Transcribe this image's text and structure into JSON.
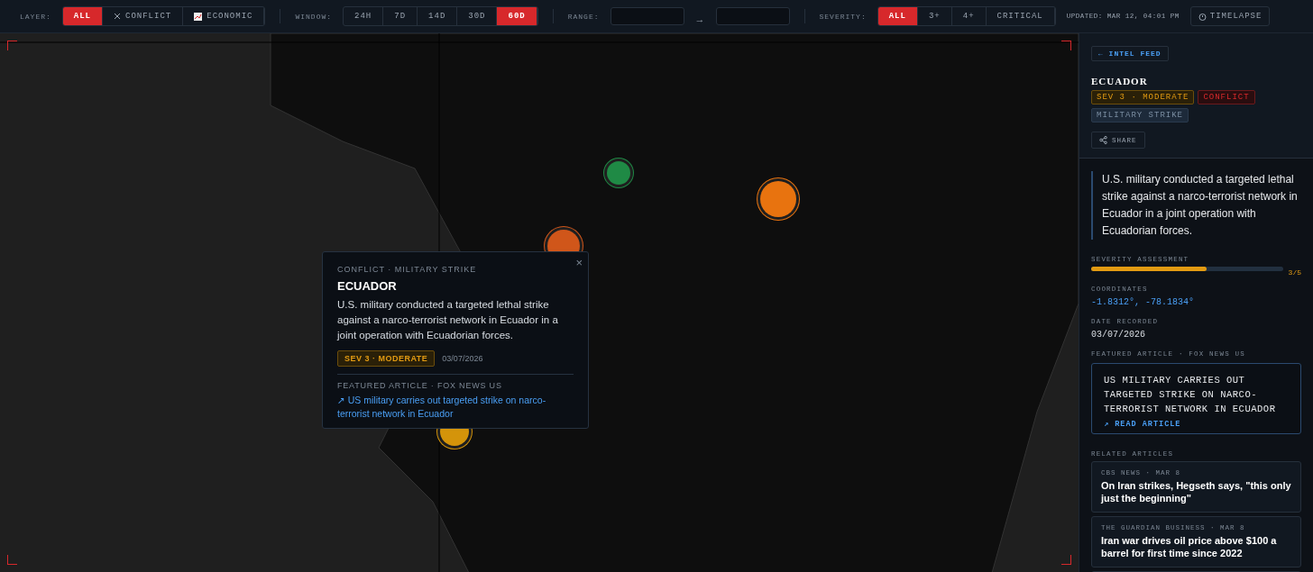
{
  "toolbar": {
    "groups": [
      {
        "label": "LAYER:",
        "options": [
          {
            "text": "ALL",
            "selected": true
          },
          {
            "text": "CONFLICT",
            "selected": false
          },
          {
            "text": "ECONOMIC",
            "selected": false
          }
        ]
      },
      {
        "label": "WINDOW:",
        "options": [
          {
            "text": "24H",
            "selected": false
          },
          {
            "text": "7D",
            "selected": false
          },
          {
            "text": "14D",
            "selected": false
          },
          {
            "text": "30D",
            "selected": false
          },
          {
            "text": "60D",
            "selected": true
          }
        ]
      }
    ],
    "range": {
      "label": "RANGE:",
      "arrow": "→"
    },
    "severity": {
      "label": "SEVERITY:",
      "options": [
        {
          "text": "ALL",
          "selected": true
        },
        {
          "text": "3+",
          "selected": false
        },
        {
          "text": "4+",
          "selected": false
        },
        {
          "text": "CRITICAL",
          "selected": false
        }
      ]
    },
    "updated": "UPDATED: MAR 12, 04:01 PM",
    "timelapse": "TIMELAPSE"
  },
  "map": {
    "markers": [
      {
        "color": "#1f8a45"
      },
      {
        "color": "#e8730f"
      },
      {
        "color": "#d0561a"
      },
      {
        "color": "#d4940a"
      }
    ],
    "popup": {
      "category": "CONFLICT · MILITARY STRIKE",
      "close": "×",
      "title": "ECUADOR",
      "body": "U.S. military conducted a targeted lethal strike against a narco-terrorist network in Ecuador in a joint operation with Ecuadorian forces.",
      "severity": "SEV 3 · MODERATE",
      "date": "03/07/2026",
      "featured_label": "FEATURED ARTICLE · FOX NEWS US",
      "link": "↗ US military carries out targeted strike on narco-terrorist network in Ecuador"
    }
  },
  "detail": {
    "back": "← INTEL FEED",
    "title": "ECUADOR",
    "tags": [
      {
        "text": "SEV 3 · MODERATE",
        "kind": "severity"
      },
      {
        "text": "CONFLICT",
        "kind": "category"
      },
      {
        "text": "MILITARY STRIKE",
        "kind": "type"
      }
    ],
    "share": "SHARE",
    "summary": "U.S. military conducted a targeted lethal strike against a narco-terrorist network in Ecuador in a joint operation with Ecuadorian forces.",
    "severity": {
      "label": "SEVERITY ASSESSMENT",
      "level": 0.6,
      "value": "3/5"
    },
    "coordinates_label": "COORDINATES",
    "coordinates": "-1.8312°, -78.1834°",
    "date_label": "DATE RECORDED",
    "date": "03/07/2026",
    "featured_label": "FEATURED ARTICLE · FOX NEWS US",
    "featured": {
      "headline": "US MILITARY CARRIES OUT TARGETED STRIKE ON NARCO-TERRORIST NETWORK IN ECUADOR",
      "link": "↗ READ ARTICLE"
    },
    "related_label": "RELATED ARTICLES",
    "related": [
      {
        "source": "CBS NEWS · MAR 8",
        "title": "On Iran strikes, Hegseth says, \"this only just the beginning\""
      },
      {
        "source": "THE GUARDIAN BUSINESS · MAR 8",
        "title": "Iran war drives oil price above $100 a barrel for first time since 2022"
      }
    ]
  }
}
